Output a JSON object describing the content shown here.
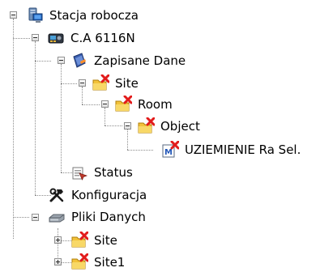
{
  "tree": {
    "root": {
      "label": "Stacja robocza",
      "icon": "computer-icon"
    },
    "device": {
      "label": "C.A 6116N",
      "icon": "instrument-device-icon"
    },
    "saved_data": {
      "label": "Zapisane Dane",
      "icon": "saved-data-book-icon"
    },
    "site": {
      "label": "Site",
      "icon": "folder-with-red-x-icon"
    },
    "room": {
      "label": "Room",
      "icon": "folder-with-red-x-icon"
    },
    "object": {
      "label": "Object",
      "icon": "folder-with-red-x-icon"
    },
    "measurement": {
      "label": "UZIEMIENIE Ra Sel.",
      "icon": "measurement-doc-icon"
    },
    "status": {
      "label": "Status",
      "icon": "status-icon"
    },
    "config": {
      "label": "Konfiguracja",
      "icon": "tools-icon"
    },
    "data_files": {
      "label": "Pliki Danych",
      "icon": "data-files-drive-icon"
    },
    "files_site": {
      "label": "Site",
      "icon": "folder-with-red-x-icon"
    },
    "files_site1": {
      "label": "Site1",
      "icon": "folder-with-red-x-icon"
    }
  },
  "colors": {
    "folder": "#f2c23a",
    "red_x": "#e21b1b",
    "tree_line": "#8c8c8c"
  }
}
